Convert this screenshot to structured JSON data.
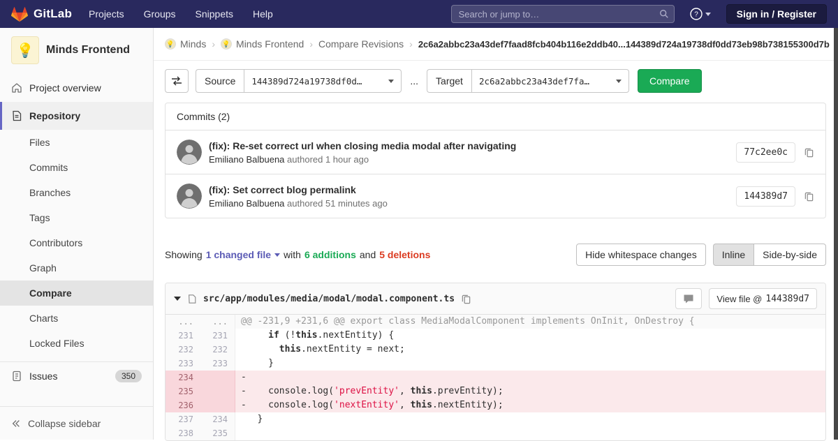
{
  "colors": {
    "header_bg": "#29295e",
    "accent_purple": "#5b5bb5",
    "green": "#1aaa55",
    "red": "#db3b21",
    "deletion_bg": "#fbe9eb"
  },
  "header": {
    "logo": "GitLab",
    "nav_items": [
      "Projects",
      "Groups",
      "Snippets",
      "Help"
    ],
    "search_placeholder": "Search or jump to…",
    "sign_in_label": "Sign in / Register"
  },
  "sidebar": {
    "project_avatar_emoji": "💡",
    "project_name": "Minds Frontend",
    "project_overview_label": "Project overview",
    "repository_label": "Repository",
    "repository_items": [
      "Files",
      "Commits",
      "Branches",
      "Tags",
      "Contributors",
      "Graph",
      "Compare",
      "Charts",
      "Locked Files"
    ],
    "active_item": "Compare",
    "issues_label": "Issues",
    "issues_count": "350",
    "collapse_label": "Collapse sidebar"
  },
  "breadcrumb": {
    "items": [
      {
        "label": "Minds",
        "avatar": "💡"
      },
      {
        "label": "Minds Frontend",
        "avatar": "💡"
      },
      {
        "label": "Compare Revisions",
        "avatar": ""
      }
    ],
    "current": "2c6a2abbc23a43def7faad8fcb404b116e2ddb40...144389d724a19738df0dd73eb98b738155300d7b"
  },
  "compare_form": {
    "source_label": "Source",
    "source_value": "144389d724a19738df0d…",
    "separator": "...",
    "target_label": "Target",
    "target_value": "2c6a2abbc23a43def7fa…",
    "compare_button": "Compare"
  },
  "commits": {
    "title": "Commits (2)",
    "items": [
      {
        "title": "(fix): Re-set correct url when closing media modal after navigating",
        "author": "Emiliano Balbuena",
        "authored": "authored 1 hour ago",
        "sha": "77c2ee0c"
      },
      {
        "title": "(fix): Set correct blog permalink",
        "author": "Emiliano Balbuena",
        "authored": "authored 51 minutes ago",
        "sha": "144389d7"
      }
    ]
  },
  "summary": {
    "showing": "Showing",
    "changed_files": "1 changed file",
    "with_text": "with",
    "additions": "6 additions",
    "and_text": "and",
    "deletions": "5 deletions",
    "hide_whitespace": "Hide whitespace changes",
    "inline": "Inline",
    "side_by_side": "Side-by-side"
  },
  "diff": {
    "file_path": "src/app/modules/media/modal/modal.component.ts",
    "view_file_label": "View file @",
    "view_file_sha": "144389d7",
    "lines": [
      {
        "type": "hunk",
        "old": "...",
        "new": "...",
        "segments": [
          {
            "t": "@@ -231,9 +231,6 @@ export class MediaModalComponent implements OnInit, OnDestroy {",
            "c": ""
          }
        ]
      },
      {
        "type": "context",
        "old": "231",
        "new": "231",
        "segments": [
          {
            "t": "    ",
            "c": ""
          },
          {
            "t": "if",
            "c": "k"
          },
          {
            "t": " (!",
            "c": ""
          },
          {
            "t": "this",
            "c": "k"
          },
          {
            "t": ".nextEntity) {",
            "c": ""
          }
        ]
      },
      {
        "type": "context",
        "old": "232",
        "new": "232",
        "segments": [
          {
            "t": "      ",
            "c": ""
          },
          {
            "t": "this",
            "c": "k"
          },
          {
            "t": ".nextEntity = next;",
            "c": ""
          }
        ]
      },
      {
        "type": "context",
        "old": "233",
        "new": "233",
        "segments": [
          {
            "t": "    }",
            "c": ""
          }
        ]
      },
      {
        "type": "deletion",
        "old": "234",
        "new": "",
        "segments": []
      },
      {
        "type": "deletion",
        "old": "235",
        "new": "",
        "segments": [
          {
            "t": "    console.log(",
            "c": ""
          },
          {
            "t": "'prevEntity'",
            "c": "s"
          },
          {
            "t": ", ",
            "c": ""
          },
          {
            "t": "this",
            "c": "k"
          },
          {
            "t": ".prevEntity);",
            "c": ""
          }
        ]
      },
      {
        "type": "deletion",
        "old": "236",
        "new": "",
        "segments": [
          {
            "t": "    console.log(",
            "c": ""
          },
          {
            "t": "'nextEntity'",
            "c": "s"
          },
          {
            "t": ", ",
            "c": ""
          },
          {
            "t": "this",
            "c": "k"
          },
          {
            "t": ".nextEntity);",
            "c": ""
          }
        ]
      },
      {
        "type": "context",
        "old": "237",
        "new": "234",
        "segments": [
          {
            "t": "  }",
            "c": ""
          }
        ]
      },
      {
        "type": "context",
        "old": "238",
        "new": "235",
        "segments": []
      }
    ]
  }
}
